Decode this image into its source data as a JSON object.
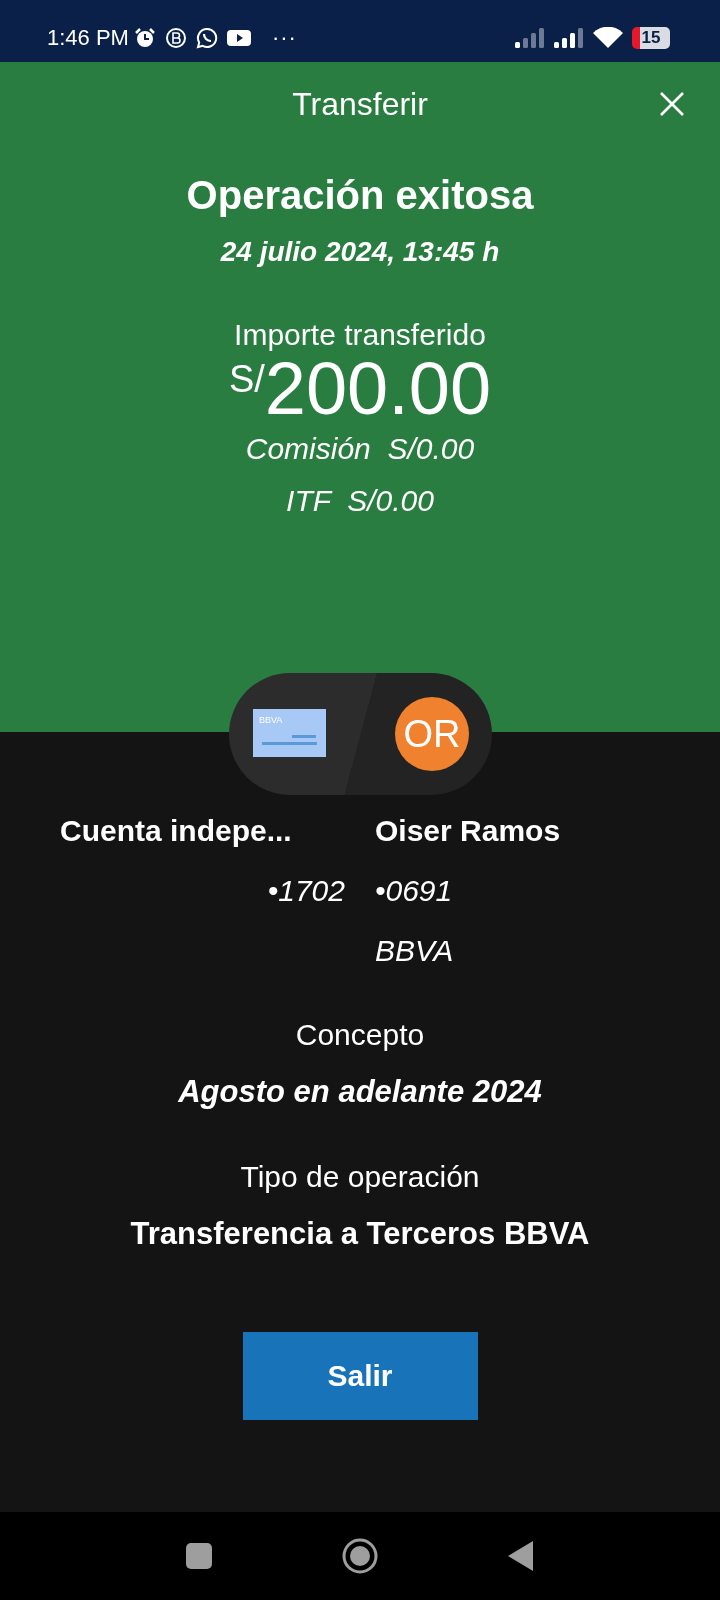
{
  "status_bar": {
    "time": "1:46 PM",
    "more": "···",
    "battery": "15"
  },
  "header": {
    "title": "Transferir"
  },
  "result": {
    "title": "Operación exitosa",
    "date": "24 julio 2024, 13:45 h"
  },
  "amount": {
    "label": "Importe transferido",
    "currency": "S/",
    "value": "200.00",
    "commission": "Comisión  S/0.00",
    "itf": "ITF  S/0.00"
  },
  "origin": {
    "name": "Cuenta indepe...",
    "account": "•1702",
    "card_brand": "BBVA"
  },
  "destination": {
    "initials": "OR",
    "name": "Oiser Ramos",
    "account": "•0691",
    "bank": "BBVA"
  },
  "details": [
    {
      "label": "Concepto",
      "value": "Agosto en adelante 2024",
      "kind": "italic"
    },
    {
      "label": "Tipo de operación",
      "value": "Transferencia a Terceros BBVA",
      "kind": "plain"
    }
  ],
  "button": "Salir"
}
